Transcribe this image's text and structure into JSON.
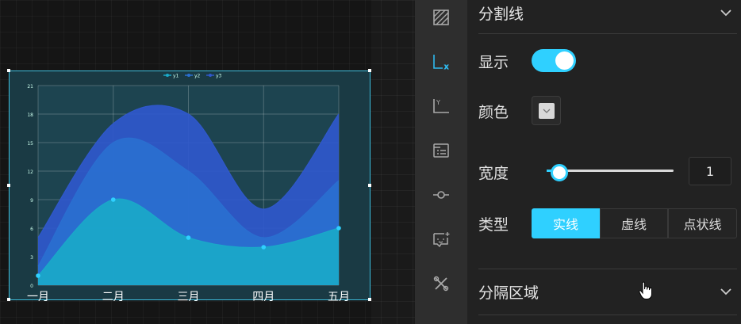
{
  "chart_data": {
    "type": "area",
    "categories": [
      "一月",
      "二月",
      "三月",
      "四月",
      "五月"
    ],
    "series": [
      {
        "name": "y1",
        "values": [
          1,
          9,
          5,
          4,
          6
        ],
        "color": "#1aa9c9"
      },
      {
        "name": "y2",
        "values": [
          2,
          15,
          12,
          5,
          11
        ],
        "color": "#2a6fd0"
      },
      {
        "name": "y3",
        "values": [
          5,
          17,
          18,
          8,
          18
        ],
        "color": "#2f58cc"
      }
    ],
    "yticks": [
      "0",
      "3",
      "6",
      "9",
      "12",
      "15",
      "18",
      "21"
    ],
    "ylim": [
      0,
      21
    ],
    "grid": true,
    "legend_position": "top"
  },
  "panel": {
    "split_line_title": "分割线",
    "show_label": "显示",
    "color_label": "颜色",
    "width_label": "宽度",
    "width_value": "1",
    "type_label": "类型",
    "type_options": [
      "实线",
      "虚线",
      "点状线"
    ],
    "split_area_title": "分隔区域",
    "show_enabled": true,
    "width_min": 0,
    "width_max": 10,
    "width_fraction": 0.1,
    "line_color": "#d8d8d8",
    "accent_color": "#2fd0ff"
  },
  "rail": {
    "icons": [
      "fill-pattern-icon",
      "x-axis-icon",
      "y-axis-icon",
      "legend-icon",
      "point-icon",
      "tooltip-icon",
      "tools-icon"
    ],
    "active_index": 1
  }
}
